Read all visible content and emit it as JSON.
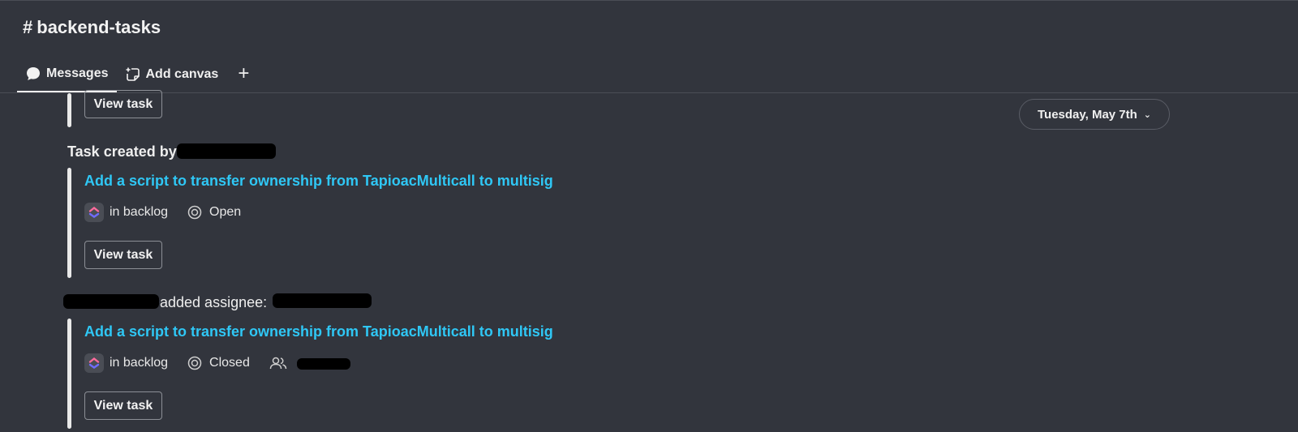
{
  "channel": {
    "hash": "#",
    "name": "backend-tasks"
  },
  "tabs": [
    {
      "label": "Messages",
      "icon": "chat-bubble-icon",
      "active": true
    },
    {
      "label": "Add canvas",
      "icon": "canvas-add-icon",
      "active": false
    }
  ],
  "add_tab_symbol": "+",
  "date_divider": {
    "label": "Tuesday, May 7th"
  },
  "messages": [
    {
      "view_button": "View task"
    },
    {
      "prefix": "Task created by",
      "task_title": "Add a script to transfer ownership from TapioacMulticall to multisig",
      "list": "in backlog",
      "status": "Open",
      "view_button": "View task"
    },
    {
      "suffix": "added assignee:",
      "task_title": "Add a script to transfer ownership from TapioacMulticall to multisig",
      "list": "in backlog",
      "status": "Closed",
      "view_button": "View task"
    }
  ],
  "colors": {
    "background": "#32353d",
    "link": "#2fc7f5",
    "text": "#eeeeee"
  }
}
